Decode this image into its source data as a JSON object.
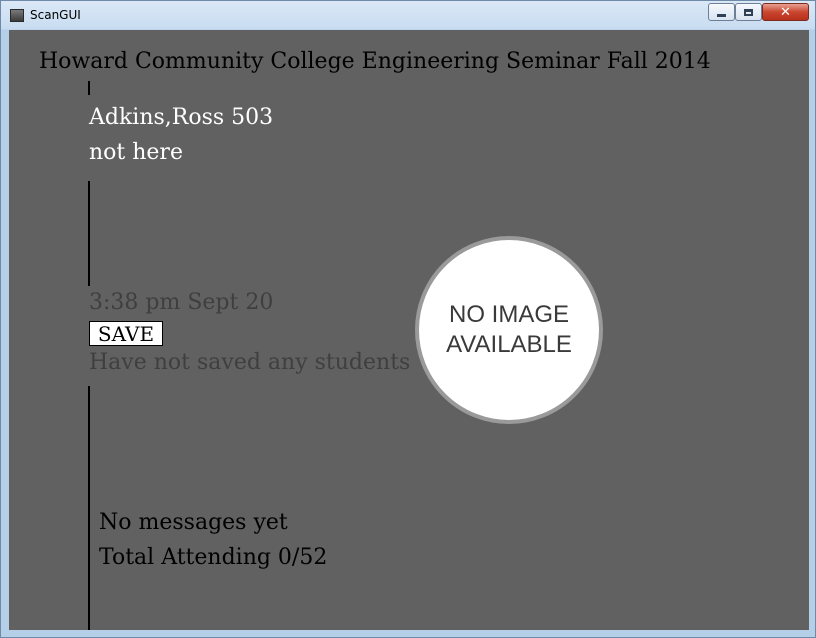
{
  "window": {
    "title": "ScanGUI",
    "controls": {
      "minimize": "minimize",
      "maximize": "maximize",
      "close": "✕"
    }
  },
  "header": {
    "title": "Howard Community College Engineering Seminar Fall 2014"
  },
  "student": {
    "name": "Adkins,Ross 503",
    "status": "not here"
  },
  "scan": {
    "timestamp": "3:38 pm Sept 20"
  },
  "save": {
    "label": "SAVE",
    "status": "Have not saved any students"
  },
  "photo": {
    "line1": "NO IMAGE",
    "line2": "AVAILABLE"
  },
  "footer": {
    "messages": "No messages yet",
    "attendance": "Total Attending 0/52"
  },
  "colors": {
    "background": "#616161",
    "name_text": "#ffffff",
    "muted_text": "#3f3f3f"
  }
}
